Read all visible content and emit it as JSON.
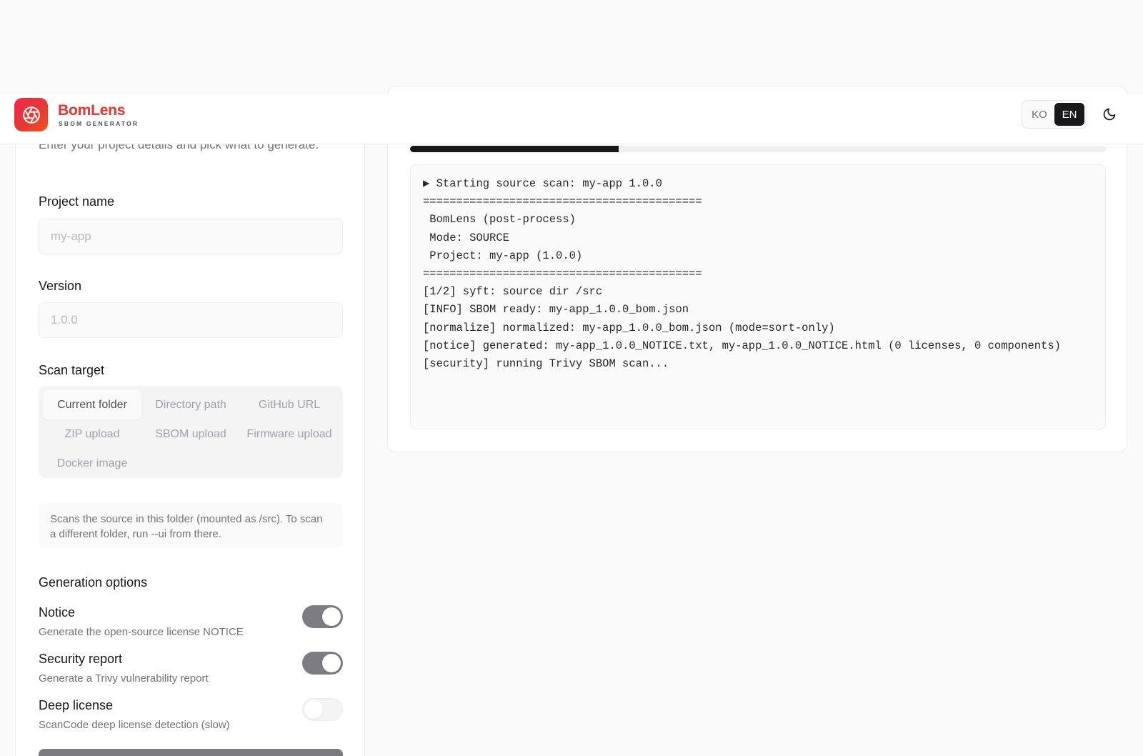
{
  "header": {
    "brand_name": "BomLens",
    "brand_subtitle": "SBOM GENERATOR",
    "languages": [
      {
        "label": "KO",
        "active": false
      },
      {
        "label": "EN",
        "active": true
      }
    ],
    "theme_icon": "moon-icon",
    "logo_icon": "aperture-icon"
  },
  "left": {
    "intro": "Enter your project details and pick what to generate.",
    "project_name": {
      "label": "Project name",
      "placeholder": "my-app"
    },
    "version": {
      "label": "Version",
      "placeholder": "1.0.0"
    },
    "scan_target": {
      "label": "Scan target",
      "options": [
        "Current folder",
        "Directory path",
        "GitHub URL",
        "ZIP upload",
        "SBOM upload",
        "Firmware upload",
        "Docker image"
      ],
      "selected": "Current folder",
      "hint": "Scans the source in this folder (mounted as /src). To scan a different folder, run --ui from there."
    },
    "generation": {
      "title": "Generation options",
      "options": [
        {
          "title": "Notice",
          "desc": "Generate the open-source license NOTICE",
          "enabled": true
        },
        {
          "title": "Security report",
          "desc": "Generate a Trivy vulnerability report",
          "enabled": true
        },
        {
          "title": "Deep license",
          "desc": "ScanCode deep license detection (slow)",
          "enabled": false
        }
      ]
    }
  },
  "right": {
    "progress_percent": 30,
    "log_lines": [
      "▶ Starting source scan: my-app 1.0.0",
      "==========================================",
      " BomLens (post-process)",
      " Mode: SOURCE",
      " Project: my-app (1.0.0)",
      "==========================================",
      "[1/2] syft: source dir /src",
      "[INFO] SBOM ready: my-app_1.0.0_bom.json",
      "[normalize] normalized: my-app_1.0.0_bom.json (mode=sort-only)",
      "[notice] generated: my-app_1.0.0_NOTICE.txt, my-app_1.0.0_NOTICE.html (0 licenses, 0 components)",
      "[security] running Trivy SBOM scan..."
    ]
  },
  "colors": {
    "accent": "#e53935",
    "dark": "#18181b",
    "toggle_on": "#7c7c82"
  }
}
